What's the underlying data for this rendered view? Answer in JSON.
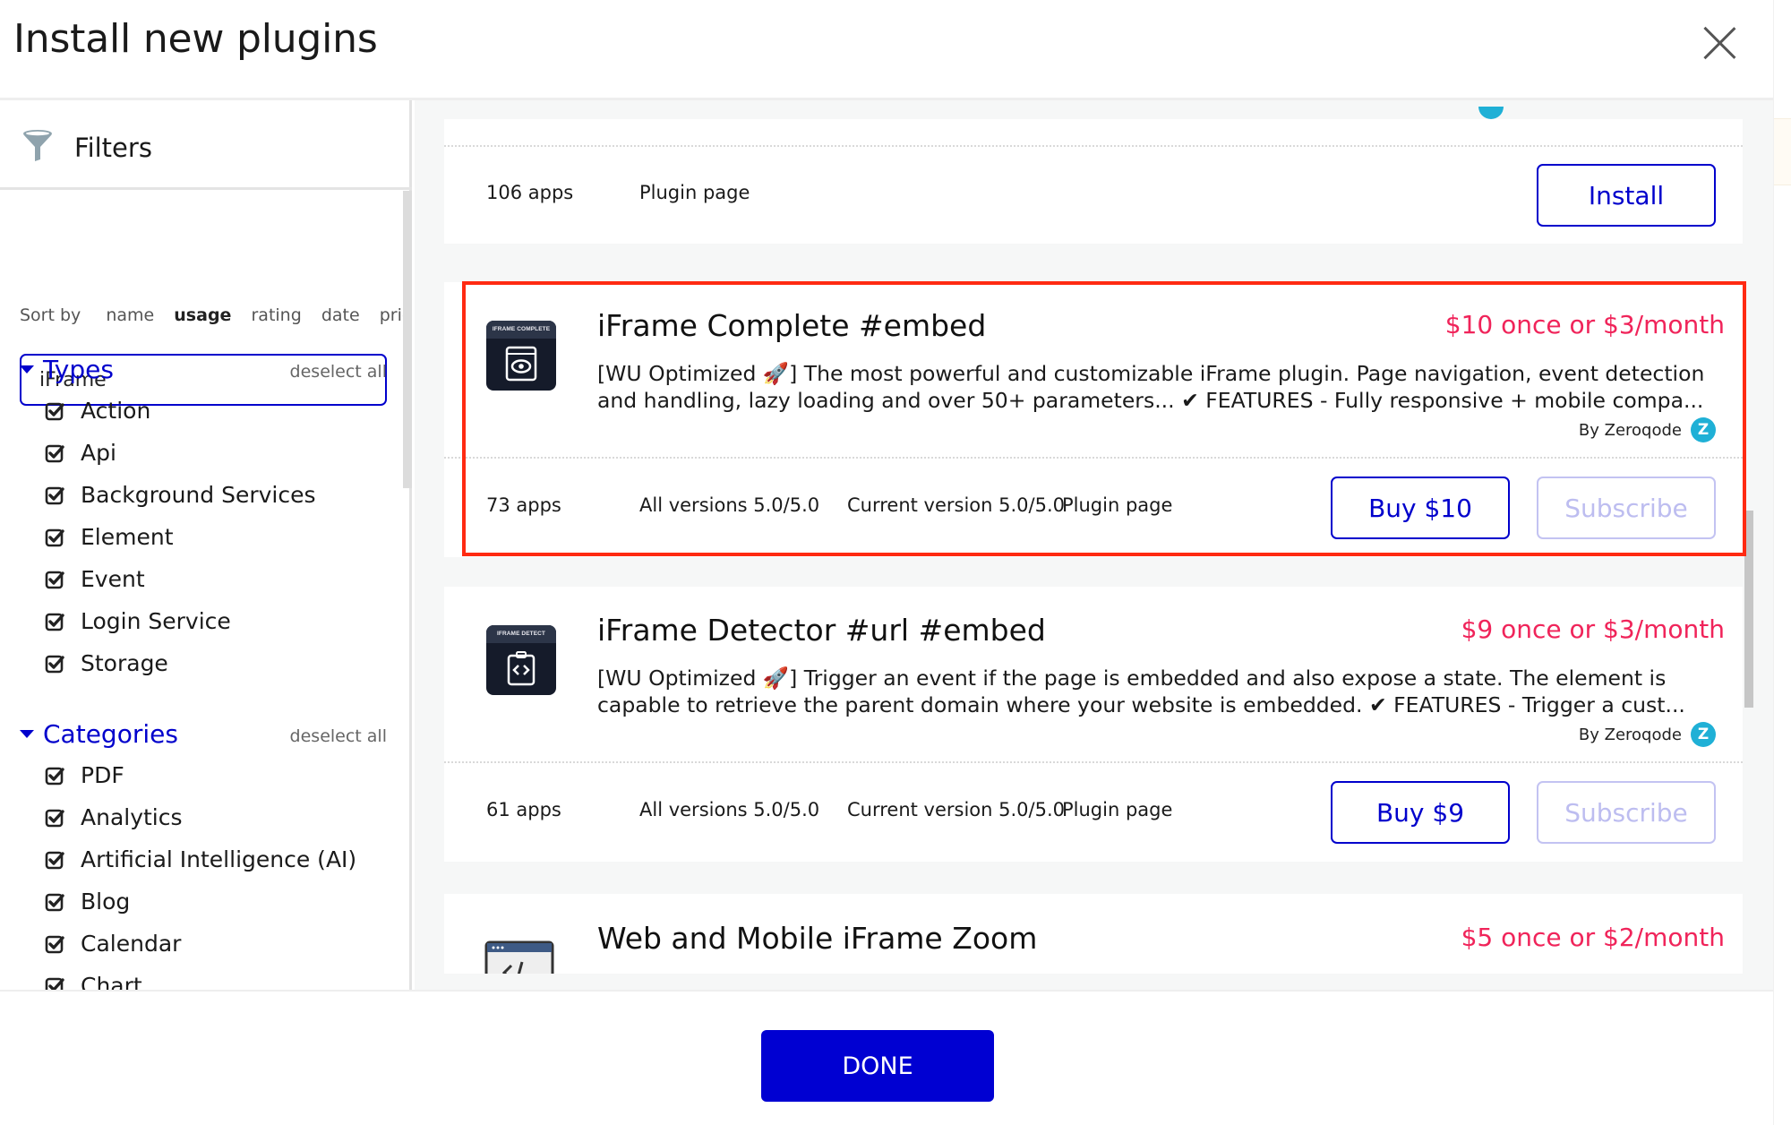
{
  "header": {
    "title": "Install new plugins",
    "close_icon": "close-icon"
  },
  "sidebar": {
    "filters_label": "Filters",
    "filter_icon": "funnel-icon",
    "sort": {
      "label": "Sort by",
      "options": [
        "name",
        "usage",
        "rating",
        "date",
        "price"
      ],
      "active": "usage"
    },
    "search": {
      "value": "iFrame",
      "placeholder": ""
    },
    "types": {
      "title": "Types",
      "deselect_label": "deselect all",
      "items": [
        {
          "label": "Action",
          "checked": true
        },
        {
          "label": "Api",
          "checked": true
        },
        {
          "label": "Background Services",
          "checked": true
        },
        {
          "label": "Element",
          "checked": true
        },
        {
          "label": "Event",
          "checked": true
        },
        {
          "label": "Login Service",
          "checked": true
        },
        {
          "label": "Storage",
          "checked": true
        }
      ]
    },
    "categories": {
      "title": "Categories",
      "deselect_label": "deselect all",
      "items": [
        {
          "label": "PDF",
          "checked": true
        },
        {
          "label": "Analytics",
          "checked": true
        },
        {
          "label": "Artificial Intelligence (AI)",
          "checked": true
        },
        {
          "label": "Blog",
          "checked": true
        },
        {
          "label": "Calendar",
          "checked": true
        },
        {
          "label": "Chart",
          "checked": true
        }
      ]
    }
  },
  "plugins": [
    {
      "apps": "106 apps",
      "plugin_page": "Plugin page",
      "install_label": "Install"
    },
    {
      "icon_label": "IFRAME COMPLETE",
      "icon_glyph": "eye-icon",
      "name": "iFrame Complete #embed",
      "price": "$10 once or $3/month",
      "description": "[WU Optimized 🚀] The most powerful and customizable iFrame plugin. Page navigation, event detection and handling, lazy loading and over 50+ parameters... ✔ FEATURES - Fully responsive + mobile compa...",
      "author": "By Zeroqode",
      "apps": "73 apps",
      "all_versions": "All versions 5.0/5.0",
      "current_version": "Current version 5.0/5.0",
      "plugin_page": "Plugin page",
      "buy_label": "Buy $10",
      "subscribe_label": "Subscribe",
      "highlighted": true
    },
    {
      "icon_label": "IFRAME DETECT",
      "icon_glyph": "code-clipboard-icon",
      "name": "iFrame Detector #url #embed",
      "price": "$9 once or $3/month",
      "description": "[WU Optimized 🚀] Trigger an event if the page is embedded and also expose a state. The element is capable to retrieve the parent domain where your website is embedded. ✔ FEATURES - Trigger a cust...",
      "author": "By Zeroqode",
      "apps": "61 apps",
      "all_versions": "All versions 5.0/5.0",
      "current_version": "Current version 5.0/5.0",
      "plugin_page": "Plugin page",
      "buy_label": "Buy $9",
      "subscribe_label": "Subscribe"
    },
    {
      "icon_glyph": "browser-code-icon",
      "name": "Web and Mobile iFrame Zoom",
      "price": "$5 once or $2/month"
    }
  ],
  "footer": {
    "done_label": "DONE"
  },
  "colors": {
    "accent": "#0000cc",
    "price": "#f0245a",
    "highlight": "#ff2a12",
    "zeroqode": "#1fb0d6"
  }
}
